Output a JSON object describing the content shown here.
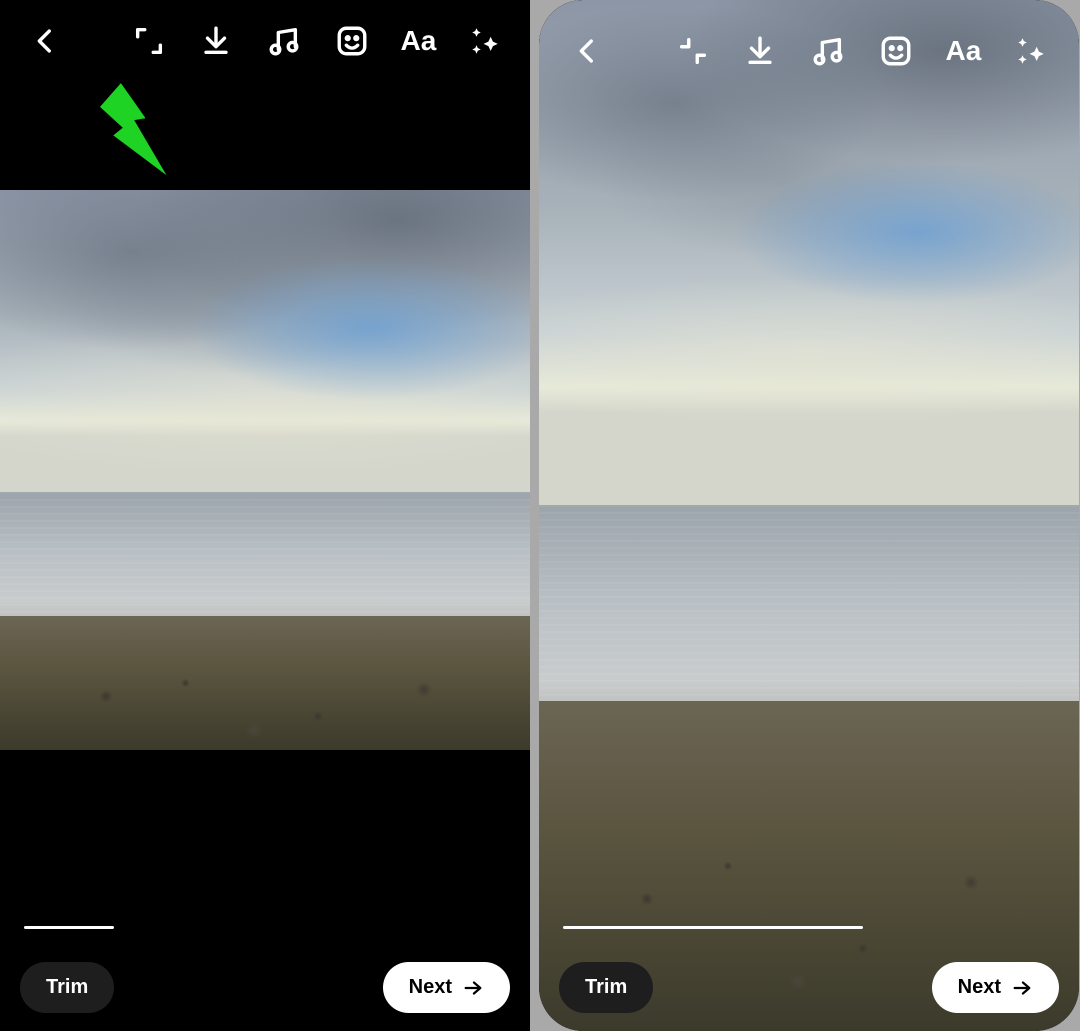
{
  "left": {
    "toolbar": {
      "back": "back",
      "crop_state": "expand",
      "text_tool": "Aa"
    },
    "bottom": {
      "trim_label": "Trim",
      "next_label": "Next"
    },
    "annotation": "arrow-pointing-to-crop-icon"
  },
  "right": {
    "toolbar": {
      "back": "back",
      "crop_state": "collapse",
      "text_tool": "Aa"
    },
    "bottom": {
      "trim_label": "Trim",
      "next_label": "Next"
    }
  },
  "colors": {
    "annotation_arrow": "#1fd324"
  }
}
